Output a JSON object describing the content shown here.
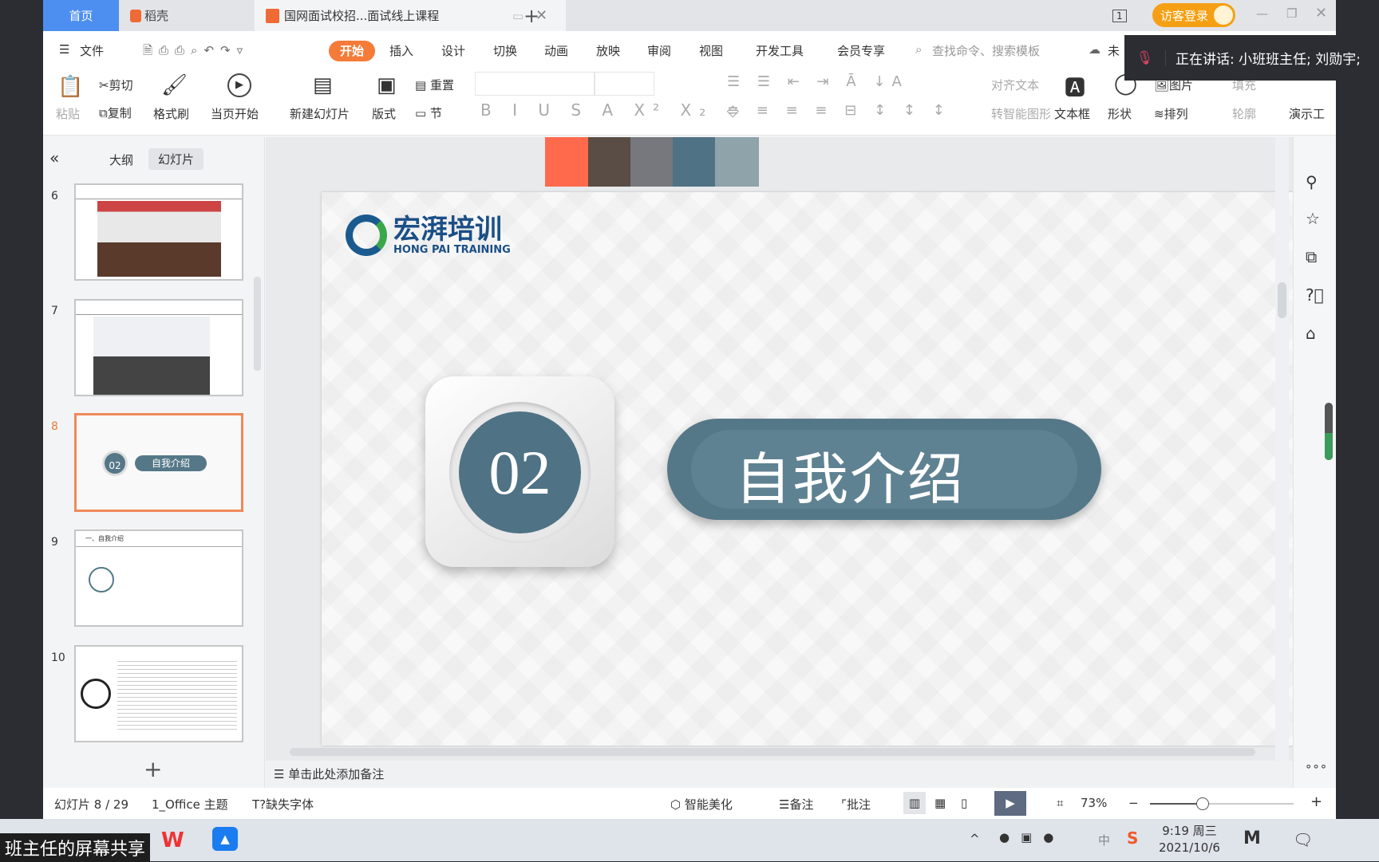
{
  "tabs": [
    {
      "label": "首页"
    },
    {
      "label": "稻壳"
    },
    {
      "label": "国网面试校招...面试线上课程"
    }
  ],
  "titlebar": {
    "page_indicator": "1",
    "login_label": "访客登录"
  },
  "menu": {
    "file": "文件",
    "items": [
      "开始",
      "插入",
      "设计",
      "切换",
      "动画",
      "放映",
      "审阅",
      "视图",
      "开发工具",
      "会员专享"
    ],
    "active": "开始",
    "search_placeholder": "查找命令、搜索模板",
    "cloud_label": "未"
  },
  "speaker": {
    "text": "正在讲话: 小班班主任; 刘勋宇;"
  },
  "toolbar": {
    "paste": "粘贴",
    "cut": "剪切",
    "copy": "复制",
    "format_painter": "格式刷",
    "play_from_current": "当页开始",
    "new_slide": "新建幻灯片",
    "layout": "版式",
    "reset": "重置",
    "section": "节",
    "align_text": "对齐文本",
    "smart_art": "转智能图形",
    "text_box": "文本框",
    "shape": "形状",
    "picture": "图片",
    "fill": "填充",
    "arrange": "排列",
    "outline": "轮廓",
    "presenter": "演示工"
  },
  "left_panel": {
    "tab_outline": "大纲",
    "tab_slides": "幻灯片",
    "active": "幻灯片",
    "slides": [
      {
        "num": "6"
      },
      {
        "num": "7"
      },
      {
        "num": "8",
        "selected": true
      },
      {
        "num": "9"
      },
      {
        "num": "10"
      }
    ],
    "thumb8_badge": "02",
    "thumb8_title": "自我介绍",
    "thumb9_heading": "一、自我介绍"
  },
  "swatches": [
    "#ff6a4d",
    "#5a4d45",
    "#76787d",
    "#4f7285",
    "#8fa3ab"
  ],
  "slide": {
    "logo_cn": "宏湃培训",
    "logo_en": "HONG PAI TRAINING",
    "badge": "02",
    "title": "自我介绍",
    "accent": "#557888"
  },
  "notes": {
    "placeholder": "单击此处添加备注"
  },
  "status": {
    "slide_counter": "幻灯片 8 / 29",
    "theme": "1_Office 主题",
    "missing_font": "缺失字体",
    "beautify": "智能美化",
    "notes": "备注",
    "comment": "批注",
    "zoom": "73%",
    "zoom_level_percent": 73
  },
  "taskbar": {
    "share_text": "班主任的屏幕共享",
    "time": "9:19 周三",
    "date": "2021/10/6",
    "ime": "中"
  }
}
